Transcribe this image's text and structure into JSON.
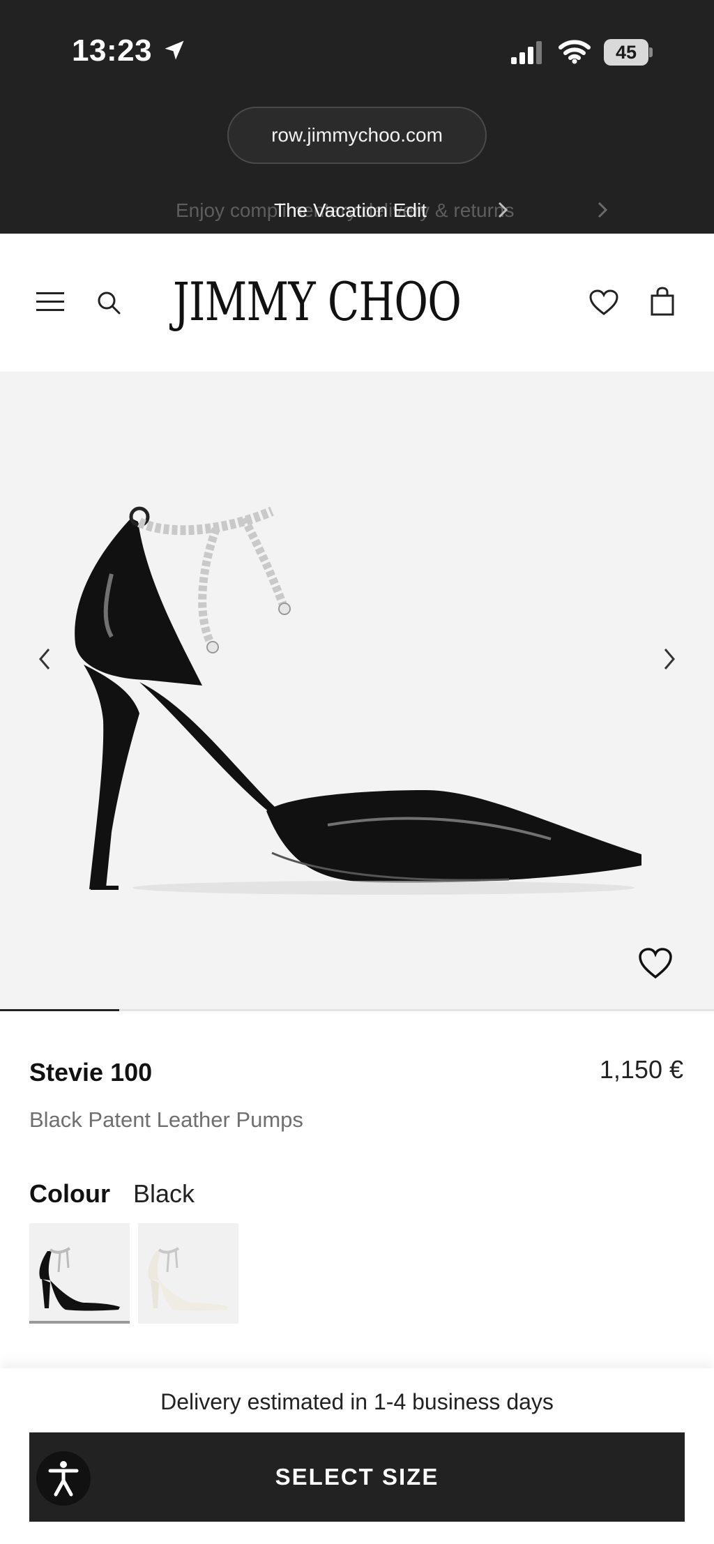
{
  "status_bar": {
    "time": "13:23",
    "battery": "45"
  },
  "browser": {
    "url": "row.jimmychoo.com"
  },
  "banner": {
    "ghost_text": "Enjoy complimentary delivery & returns",
    "main_text": "The Vacation Edit"
  },
  "header": {
    "logo": "JIMMY CHOO"
  },
  "gallery": {
    "slide": 1,
    "slide_count": 6
  },
  "product": {
    "name": "Stevie 100",
    "price": "1,150 €",
    "description": "Black Patent Leather Pumps",
    "colour_label": "Colour",
    "colour_value": "Black",
    "swatches": [
      {
        "name": "Black",
        "selected": true
      },
      {
        "name": "White",
        "selected": false
      }
    ]
  },
  "footer": {
    "delivery": "Delivery estimated in 1-4 business days",
    "cta": "SELECT SIZE"
  },
  "colors": {
    "chrome": "#222222",
    "gallery_bg": "#f3f3f3",
    "accent": "#222222",
    "muted_text": "#6f6f6f"
  },
  "icons": [
    "location-arrow-icon",
    "signal-icon",
    "wifi-icon",
    "menu-icon",
    "search-icon",
    "wishlist-icon",
    "bag-icon",
    "chevron-left-icon",
    "chevron-right-icon",
    "heart-icon",
    "accessibility-icon"
  ]
}
